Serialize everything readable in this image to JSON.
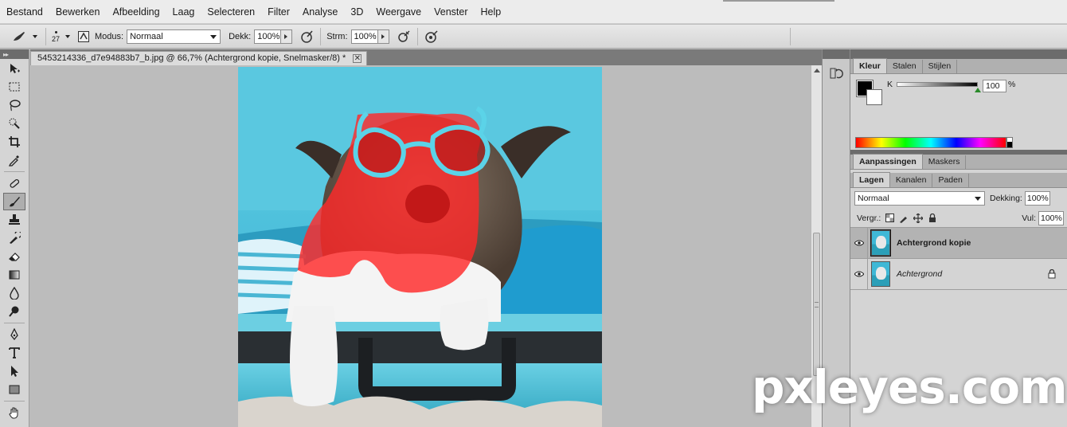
{
  "menu": [
    "Bestand",
    "Bewerken",
    "Afbeelding",
    "Laag",
    "Selecteren",
    "Filter",
    "Analyse",
    "3D",
    "Weergave",
    "Venster",
    "Help"
  ],
  "options": {
    "brush_size": "27",
    "mode_label": "Modus:",
    "mode_value": "Normaal",
    "opacity_label": "Dekk:",
    "opacity_value": "100%",
    "flow_label": "Strm:",
    "flow_value": "100%"
  },
  "document": {
    "tab_title": "5453214336_d7e94883b7_b.jpg @ 66,7% (Achtergrond kopie, Snelmasker/8) *",
    "close_glyph": "✕"
  },
  "color_panel": {
    "tabs": [
      "Kleur",
      "Stalen",
      "Stijlen"
    ],
    "channel_label": "K",
    "channel_value": "100",
    "percent_sign": "%",
    "k_level": 1.0
  },
  "adjust_panel": {
    "tabs": [
      "Aanpassingen",
      "Maskers"
    ]
  },
  "layers_panel": {
    "tabs": [
      "Lagen",
      "Kanalen",
      "Paden"
    ],
    "blend_mode": "Normaal",
    "opacity_label": "Dekking:",
    "opacity_value": "100%",
    "lock_label": "Vergr.:",
    "fill_label": "Vul:",
    "fill_value": "100%",
    "layers": [
      {
        "name": "Achtergrond kopie",
        "selected": true,
        "locked": false
      },
      {
        "name": "Achtergrond",
        "selected": false,
        "locked": true
      }
    ]
  },
  "watermark": "pxleyes.com",
  "colors": {
    "mask_red": "#ff2a2a",
    "backdrop_blue": "#4fc3dd",
    "suitcase_teal": "#3eb5cf"
  }
}
